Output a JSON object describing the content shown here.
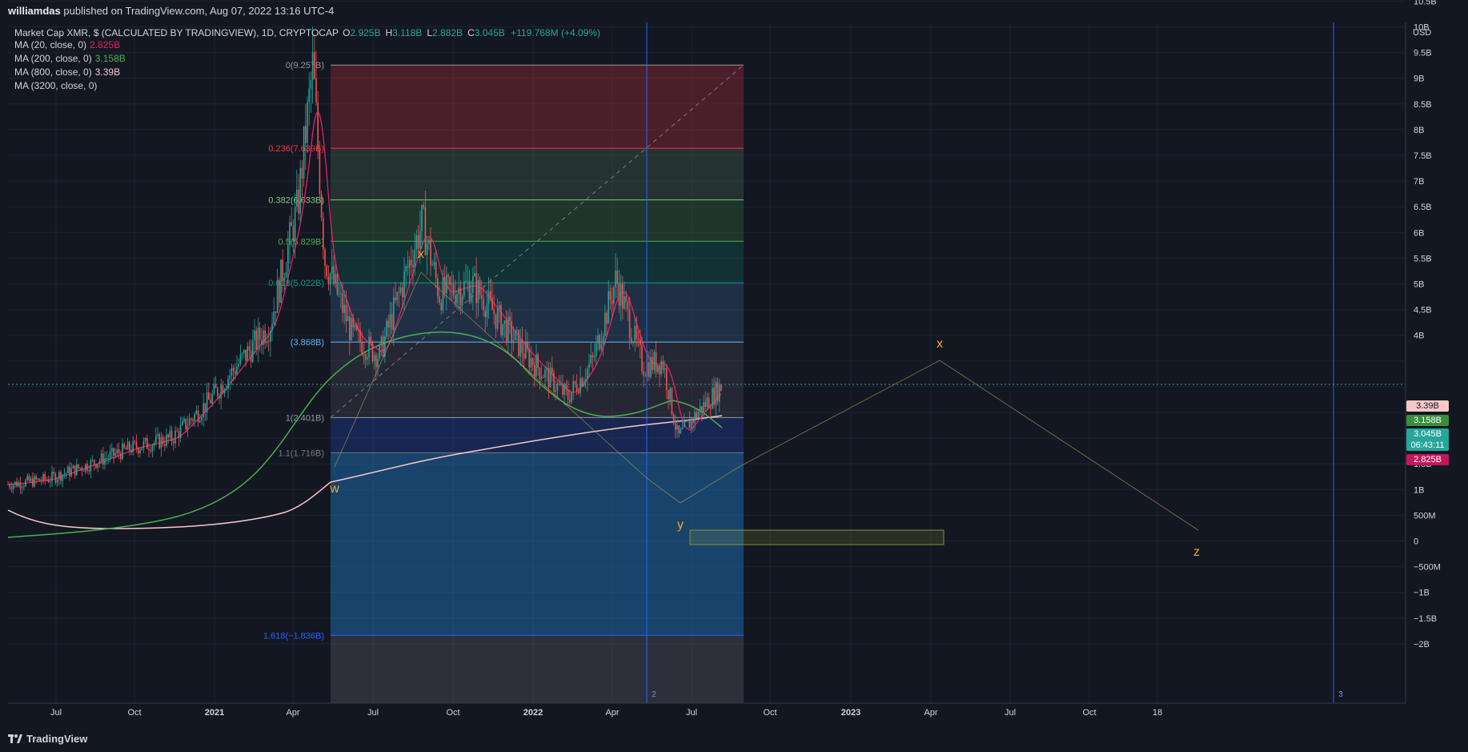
{
  "header": {
    "author": "williamdas",
    "published_text": "published on TradingView.com, Aug 07, 2022 13:16 UTC-4"
  },
  "legend": {
    "symbol": "Market Cap XMR, $ (CALCULATED BY TRADINGVIEW), 1D, CRYPTOCAP",
    "ohlc": [
      {
        "k": "O",
        "v": "2.925B"
      },
      {
        "k": "H",
        "v": "3.118B"
      },
      {
        "k": "L",
        "v": "2.882B"
      },
      {
        "k": "C",
        "v": "3.045B"
      }
    ],
    "change": "+119.768M (+4.09%)",
    "mas": [
      {
        "label": "MA (20, close, 0)",
        "value": "2.825B",
        "color": "#e91e63"
      },
      {
        "label": "MA (200, close, 0)",
        "value": "3.158B",
        "color": "#4caf50"
      },
      {
        "label": "MA (800, close, 0)",
        "value": "3.39B",
        "color": "#f8c8c8"
      },
      {
        "label": "MA (3200, close, 0)",
        "value": "",
        "color": "#d1d4dc"
      }
    ]
  },
  "price_tags": {
    "ma800": "3.39B",
    "ma200": "3.158B",
    "close": "3.045B",
    "countdown": "06:43:11",
    "ma20": "2.825B"
  },
  "footer": {
    "brand": "TradingView"
  },
  "chart_data": {
    "type": "candlestick",
    "currency_label": "USD",
    "y_axis_ticks": [
      "10.5B",
      "10B",
      "9.5B",
      "9B",
      "8.5B",
      "8B",
      "7.5B",
      "7B",
      "6.5B",
      "6B",
      "5.5B",
      "5B",
      "4.5B",
      "4B",
      "2B",
      "1.5B",
      "1B",
      "500M",
      "0",
      "−500M",
      "−1B",
      "−1.5B",
      "−2B"
    ],
    "x_axis_ticks": [
      "Jul",
      "Oct",
      "2021",
      "Apr",
      "Jul",
      "Oct",
      "2022",
      "Apr",
      "Jul",
      "Oct",
      "2023",
      "Apr",
      "Jul",
      "Oct",
      "18"
    ],
    "ylim": [
      -2.0,
      10.5
    ],
    "price_path": [
      {
        "t": "2020-06-01",
        "v": 1.1
      },
      {
        "t": "2020-07-15",
        "v": 1.2
      },
      {
        "t": "2020-09-01",
        "v": 1.5
      },
      {
        "t": "2020-10-15",
        "v": 1.8
      },
      {
        "t": "2020-12-01",
        "v": 2.0
      },
      {
        "t": "2021-01-10",
        "v": 2.7
      },
      {
        "t": "2021-02-20",
        "v": 3.6
      },
      {
        "t": "2021-03-20",
        "v": 4.2
      },
      {
        "t": "2021-04-20",
        "v": 6.5
      },
      {
        "t": "2021-05-07",
        "v": 9.257
      },
      {
        "t": "2021-05-20",
        "v": 5.5
      },
      {
        "t": "2021-06-20",
        "v": 4.0
      },
      {
        "t": "2021-07-20",
        "v": 3.6
      },
      {
        "t": "2021-08-15",
        "v": 5.0
      },
      {
        "t": "2021-09-06",
        "v": 6.2
      },
      {
        "t": "2021-09-25",
        "v": 4.8
      },
      {
        "t": "2021-11-01",
        "v": 5.0
      },
      {
        "t": "2021-12-01",
        "v": 4.3
      },
      {
        "t": "2022-01-01",
        "v": 3.6
      },
      {
        "t": "2022-02-15",
        "v": 2.8
      },
      {
        "t": "2022-03-15",
        "v": 3.5
      },
      {
        "t": "2022-04-10",
        "v": 5.1
      },
      {
        "t": "2022-05-10",
        "v": 3.4
      },
      {
        "t": "2022-06-01",
        "v": 3.5
      },
      {
        "t": "2022-06-18",
        "v": 2.0
      },
      {
        "t": "2022-07-10",
        "v": 2.5
      },
      {
        "t": "2022-08-07",
        "v": 3.045
      }
    ],
    "fib_levels": [
      {
        "ratio": "0",
        "value": 9.257,
        "label": "0(9.257B)",
        "color": "#9598a1"
      },
      {
        "ratio": "0.236",
        "value": 7.639,
        "label": "0.236(7.639B)",
        "color": "#f23645"
      },
      {
        "ratio": "0.382",
        "value": 6.633,
        "label": "0.382(6.633B)",
        "color": "#81c784"
      },
      {
        "ratio": "0.5",
        "value": 5.829,
        "label": "0.5(5.829B)",
        "color": "#4caf50"
      },
      {
        "ratio": "0.618",
        "value": 5.022,
        "label": "0.618(5.022B)",
        "color": "#089981"
      },
      {
        "ratio": "0.786",
        "value": 3.868,
        "label": "(3.868B)",
        "color": "#64b5f6"
      },
      {
        "ratio": "1",
        "value": 2.401,
        "label": "1(2.401B)",
        "color": "#9598a1"
      },
      {
        "ratio": "1.1",
        "value": 1.716,
        "label": "1.1(1.716B)",
        "color": "#787b86"
      },
      {
        "ratio": "1.618",
        "value": -1.836,
        "label": "1.618(−1.836B)",
        "color": "#2962ff"
      }
    ],
    "wave_labels": [
      "w",
      "x",
      "y",
      "x",
      "z"
    ],
    "vertical_line_labels": [
      "2",
      "3"
    ]
  }
}
